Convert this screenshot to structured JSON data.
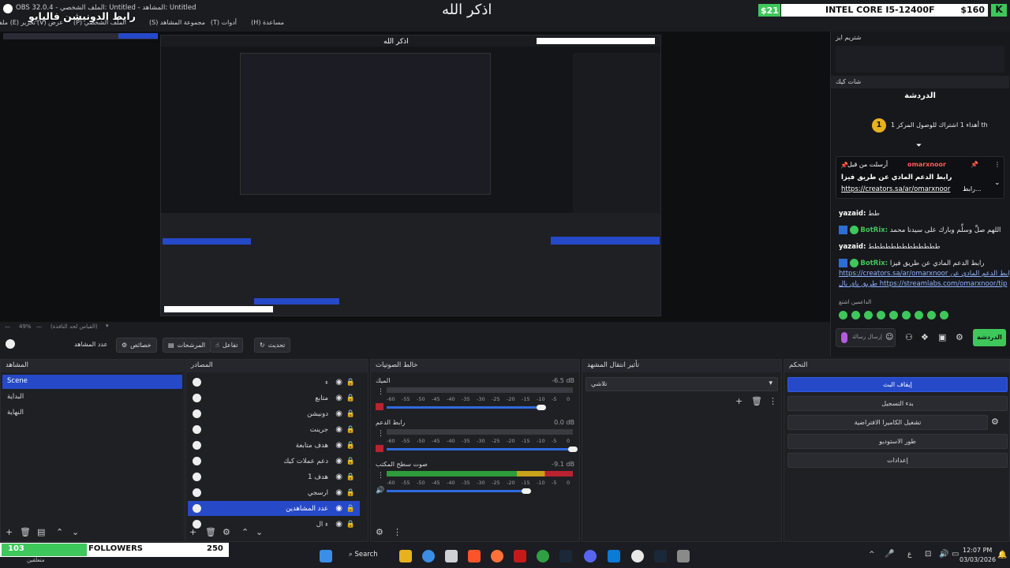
{
  "window": {
    "title": "OBS 32.0.4 - الملف الشخصي: Untitled - المشاهد: Untitled",
    "overlay_name": "رابط الدونيشن فاليايو",
    "top_center": "اذكر الله"
  },
  "menu": [
    "ملف (F)",
    "تحرير (E)",
    "عرض (V)",
    "الملف الشخصي (P)",
    "مجموعة المشاهد (S)",
    "أدوات (T)",
    "مساعدة (H)"
  ],
  "overlay": {
    "left_value": "$21",
    "cpu": "INTEL CORE I5-12400F",
    "right_value": "$160"
  },
  "colors": {
    "accent": "#2649c8",
    "green": "#3ec75a",
    "red": "#b8232f"
  },
  "preview": {
    "zoom": "49%",
    "fit_label": "(القياس لحد النافذة)"
  },
  "chat": {
    "header1": "شتريم ايز",
    "header2": "شات كيك",
    "panel_title": "الدردشة",
    "goal_text": "أهداء 1 اشتراك للوصول المركز 1 th",
    "goal_rank": "1",
    "pinned": {
      "user": "omarxnoor",
      "from": "أرسلت من قبل",
      "line1": "رابط الدعم المادي عن طريق فيزا",
      "link": "https://creators.sa/ar/omarxnoor",
      "suffix": "رابط..."
    },
    "messages": [
      {
        "user": "yazaid:",
        "text": "طط"
      },
      {
        "user": "BotRix:",
        "text": "اللهم صلِّ وسلِّم وبارك على سيدنا محمد"
      },
      {
        "user": "yazaid:",
        "text": "ططططططططططططط"
      },
      {
        "user": "BotRix:",
        "text": "رابط الدعم المادي عن طريق فيزا"
      },
      {
        "user": "",
        "text": "https://creators.sa/ar/omarxnoor رابط الدعم المادي عن"
      },
      {
        "user": "",
        "text": "طريق باي بال https://streamlabs.com/omarxnoor/tip"
      }
    ],
    "supporters_label": "الداعمين اشتغ",
    "send_placeholder": "إرسال رسالة",
    "send_button": "الدردشة"
  },
  "toolbar": {
    "refresh": "تحديث",
    "interact": "تفاعل",
    "filters": "المرشحات",
    "properties": "خصائص",
    "no_source": "عدد المشاهد"
  },
  "scenes": {
    "title": "المشاهد",
    "items": [
      "Scene",
      "البداية",
      "النهاية"
    ]
  },
  "sources": {
    "title": "المصادر",
    "items": [
      "ء",
      "متابع",
      "دونيشن",
      "جرينت",
      "هدف متابعة",
      "دعم عملات كيك",
      "هدف 1",
      "ارسجي",
      "عدد المشاهدين",
      "ء ال"
    ]
  },
  "mixer": {
    "title": "خالط الصوتيات",
    "ticks": [
      "-60",
      "-55",
      "-50",
      "-45",
      "-40",
      "-35",
      "-30",
      "-25",
      "-20",
      "-15",
      "-10",
      "-5",
      "0"
    ],
    "channels": [
      {
        "name": "الميك",
        "db": "-6.5 dB",
        "level": 0.83
      },
      {
        "name": "رابط الدعم",
        "db": "0.0 dB",
        "level": 1.0
      },
      {
        "name": "صوت سطح المكتب",
        "db": "-9.1 dB",
        "level": 0.75
      }
    ]
  },
  "transitions": {
    "title": "تأثير انتقال المشهد",
    "selected": "تلاشي"
  },
  "controls": {
    "title": "التحكم",
    "buttons": [
      "إيقاف البث",
      "بدء التسجيل",
      "تشغيل الكاميرا الافتراضية",
      "طور الاستوديو",
      "إعدادات"
    ]
  },
  "followers": {
    "count": "103",
    "label": "FOLLOWERS",
    "goal": "250",
    "sub": "متعلقين"
  },
  "taskbar": {
    "search": "Search",
    "lang": "ع",
    "time": "12:07 PM",
    "date": "03/03/2026"
  }
}
